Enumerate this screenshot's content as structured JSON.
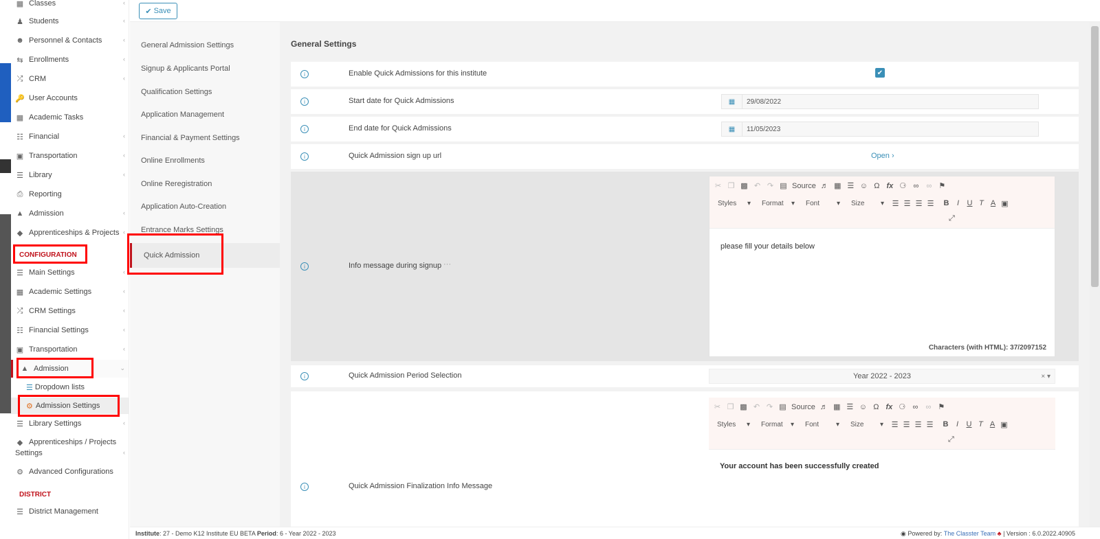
{
  "sidebar": {
    "items": [
      {
        "label": "Classes",
        "icon": "classes-icon"
      },
      {
        "label": "Students",
        "icon": "students-icon"
      },
      {
        "label": "Personnel & Contacts",
        "icon": "person-icon"
      },
      {
        "label": "Enrollments",
        "icon": "arrows-icon"
      },
      {
        "label": "CRM",
        "icon": "shuffle-icon"
      },
      {
        "label": "User Accounts",
        "icon": "key-icon"
      },
      {
        "label": "Academic Tasks",
        "icon": "grid-icon"
      },
      {
        "label": "Financial",
        "icon": "coins-icon"
      },
      {
        "label": "Transportation",
        "icon": "bus-icon"
      },
      {
        "label": "Library",
        "icon": "books-icon"
      },
      {
        "label": "Reporting",
        "icon": "printer-icon"
      },
      {
        "label": "Admission",
        "icon": "institution-icon"
      },
      {
        "label": "Apprenticeships & Projects",
        "icon": "cube-icon"
      }
    ],
    "config_title": "CONFIGURATION",
    "config_items": [
      {
        "label": "Main Settings",
        "icon": "sliders-icon"
      },
      {
        "label": "Academic Settings",
        "icon": "classes-icon"
      },
      {
        "label": "CRM Settings",
        "icon": "shuffle-icon"
      },
      {
        "label": "Financial Settings",
        "icon": "coins-icon"
      },
      {
        "label": "Transportation",
        "icon": "bus-icon"
      },
      {
        "label": "Admission",
        "icon": "institution-icon"
      }
    ],
    "admission_sub": {
      "dropdown_lists": "Dropdown lists",
      "admission_settings": "Admission Settings"
    },
    "config_items_2": [
      {
        "label": "Library Settings"
      },
      {
        "label": "Apprenticeships / Projects"
      },
      {
        "label": "Settings"
      },
      {
        "label": "Advanced Configurations"
      }
    ],
    "district_title": "DISTRICT",
    "district_items": [
      {
        "label": "District Management"
      }
    ]
  },
  "toolbar": {
    "save_label": "Save"
  },
  "settings_nav": {
    "items": [
      "General Admission Settings",
      "Signup & Applicants Portal",
      "Qualification Settings",
      "Application Management",
      "Financial & Payment Settings",
      "Online Enrollments",
      "Online Reregistration",
      "Application Auto-Creation",
      "Entrance Marks Settings",
      "Quick Admission"
    ],
    "active": "Quick Admission"
  },
  "main": {
    "title": "General Settings",
    "rows": {
      "enable": "Enable Quick Admissions for this institute",
      "start": "Start date for Quick Admissions",
      "start_value": "29/08/2022",
      "end": "End date for Quick Admissions",
      "end_value": "11/05/2023",
      "url": "Quick Admission sign up url",
      "url_link": "Open",
      "info_msg": "Info message during signup",
      "info_more": "···",
      "period": "Quick Admission Period Selection",
      "period_value": "Year 2022 - 2023",
      "final": "Quick Admission Finalization Info Message"
    },
    "editor1": {
      "source_label": "Source",
      "styles": "Styles",
      "format": "Format",
      "font": "Font",
      "size": "Size",
      "content": "please fill your details below",
      "counter": "Characters (with HTML): 37/2097152"
    },
    "editor2": {
      "source_label": "Source",
      "styles": "Styles",
      "format": "Format",
      "font": "Font",
      "size": "Size",
      "content": "Your account has been successfully created"
    }
  },
  "footer": {
    "institute_label": "Institute",
    "institute_value": ": 27 - Demo K12 Institute EU BETA",
    "period_label": "Period",
    "period_value": ": 6 - Year 2022 - 2023",
    "powered": "Powered by:",
    "team": "The Classter Team",
    "version": "| Version : 6.0.2022.40905"
  },
  "colors": {
    "accent": "#3a8fb7",
    "highlight_red": "#ff0000",
    "section_red": "#c0121b"
  }
}
